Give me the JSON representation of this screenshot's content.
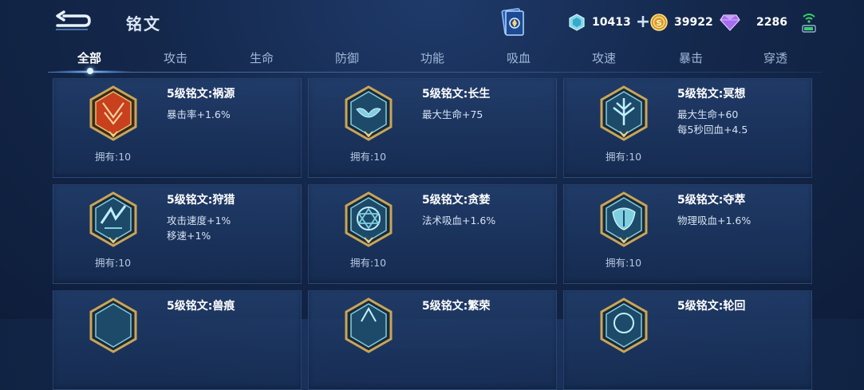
{
  "header": {
    "title": "铭文",
    "currencies": [
      {
        "icon": "diamond-icon",
        "value": "10413"
      },
      {
        "icon": "gold-coin-icon",
        "value": "39922"
      },
      {
        "icon": "purple-gem-icon",
        "value": "2286"
      }
    ]
  },
  "tabs": [
    {
      "label": "全部",
      "active": true
    },
    {
      "label": "攻击"
    },
    {
      "label": "生命"
    },
    {
      "label": "防御"
    },
    {
      "label": "功能"
    },
    {
      "label": "吸血"
    },
    {
      "label": "攻速"
    },
    {
      "label": "暴击"
    },
    {
      "label": "穿透"
    }
  ],
  "runes": [
    {
      "name": "5级铭文:祸源",
      "stats": [
        "暴击率+1.6%"
      ],
      "owned": "拥有:10",
      "color": "red"
    },
    {
      "name": "5级铭文:长生",
      "stats": [
        "最大生命+75"
      ],
      "owned": "拥有:10",
      "color": "blue"
    },
    {
      "name": "5级铭文:冥想",
      "stats": [
        "最大生命+60",
        "每5秒回血+4.5"
      ],
      "owned": "拥有:10",
      "color": "blue"
    },
    {
      "name": "5级铭文:狩猎",
      "stats": [
        "攻击速度+1%",
        "移速+1%"
      ],
      "owned": "拥有:10",
      "color": "blue"
    },
    {
      "name": "5级铭文:贪婪",
      "stats": [
        "法术吸血+1.6%"
      ],
      "owned": "拥有:10",
      "color": "blue"
    },
    {
      "name": "5级铭文:夺萃",
      "stats": [
        "物理吸血+1.6%"
      ],
      "owned": "拥有:10",
      "color": "blue"
    },
    {
      "name": "5级铭文:兽痕",
      "stats": [],
      "owned": "",
      "color": "blue"
    },
    {
      "name": "5级铭文:繁荣",
      "stats": [],
      "owned": "",
      "color": "blue"
    },
    {
      "name": "5级铭文:轮回",
      "stats": [],
      "owned": "",
      "color": "blue"
    }
  ],
  "colors": {
    "background": "#14284c",
    "card": "#1c3764",
    "gold_frame": "#c9a55a",
    "red_rune": "#c8401e",
    "blue_rune": "#7fcfe0"
  }
}
